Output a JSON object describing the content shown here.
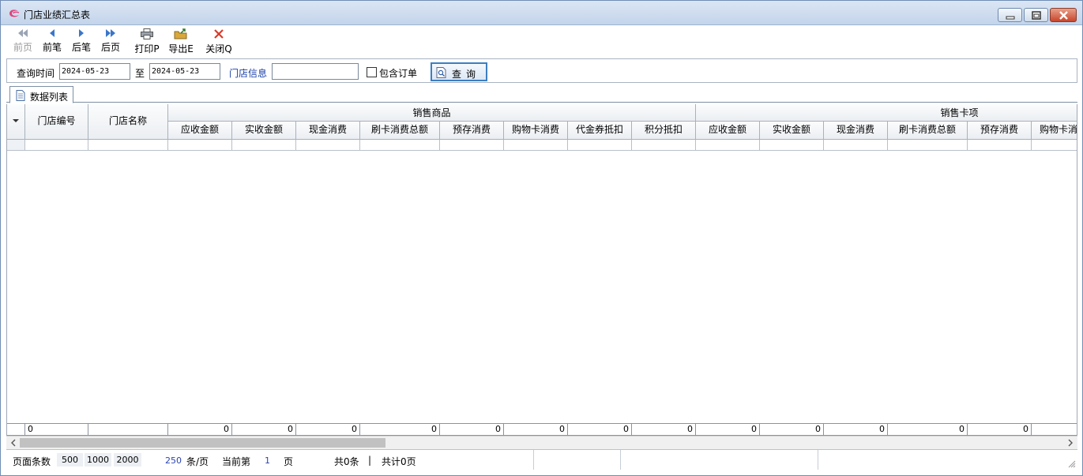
{
  "window": {
    "title": "门店业绩汇总表"
  },
  "toolbar": {
    "first_page": "前页",
    "prev_record": "前笔",
    "next_record": "后笔",
    "last_page": "后页",
    "print": "打印P",
    "export": "导出E",
    "close": "关闭Q"
  },
  "query": {
    "time_label": "查询时间",
    "date_from": "2024-05-23",
    "to_label": "至",
    "date_to": "2024-05-23",
    "store_label": "门店信息",
    "store_value": "",
    "include_orders_label": "包含订单",
    "include_orders_checked": false,
    "query_button": "查询"
  },
  "tabs": [
    {
      "label": "数据列表"
    }
  ],
  "grid": {
    "fixed_columns": [
      "门店编号",
      "门店名称"
    ],
    "groups": [
      {
        "label": "销售商品",
        "columns": [
          "应收金额",
          "实收金额",
          "现金消费",
          "刷卡消费总额",
          "预存消费",
          "购物卡消费",
          "代金券抵扣",
          "积分抵扣"
        ]
      },
      {
        "label": "销售卡项",
        "columns": [
          "应收金额",
          "实收金额",
          "现金消费",
          "刷卡消费总额",
          "预存消费",
          "购物卡消费"
        ]
      }
    ],
    "footer": {
      "store_code": "0",
      "values": [
        "0",
        "0",
        "0",
        "0",
        "0",
        "0",
        "0",
        "0",
        "0",
        "0",
        "0",
        "0",
        "0"
      ]
    }
  },
  "statusbar": {
    "page_size_label": "页面条数",
    "page_size_options": [
      "500",
      "1000",
      "2000"
    ],
    "per_page_value": "250",
    "per_page_unit": "条/页",
    "current_page_label": "当前第",
    "current_page": "1",
    "page_unit": "页",
    "total_records": "共0条",
    "separator": "|",
    "total_pages": "共计0页"
  }
}
